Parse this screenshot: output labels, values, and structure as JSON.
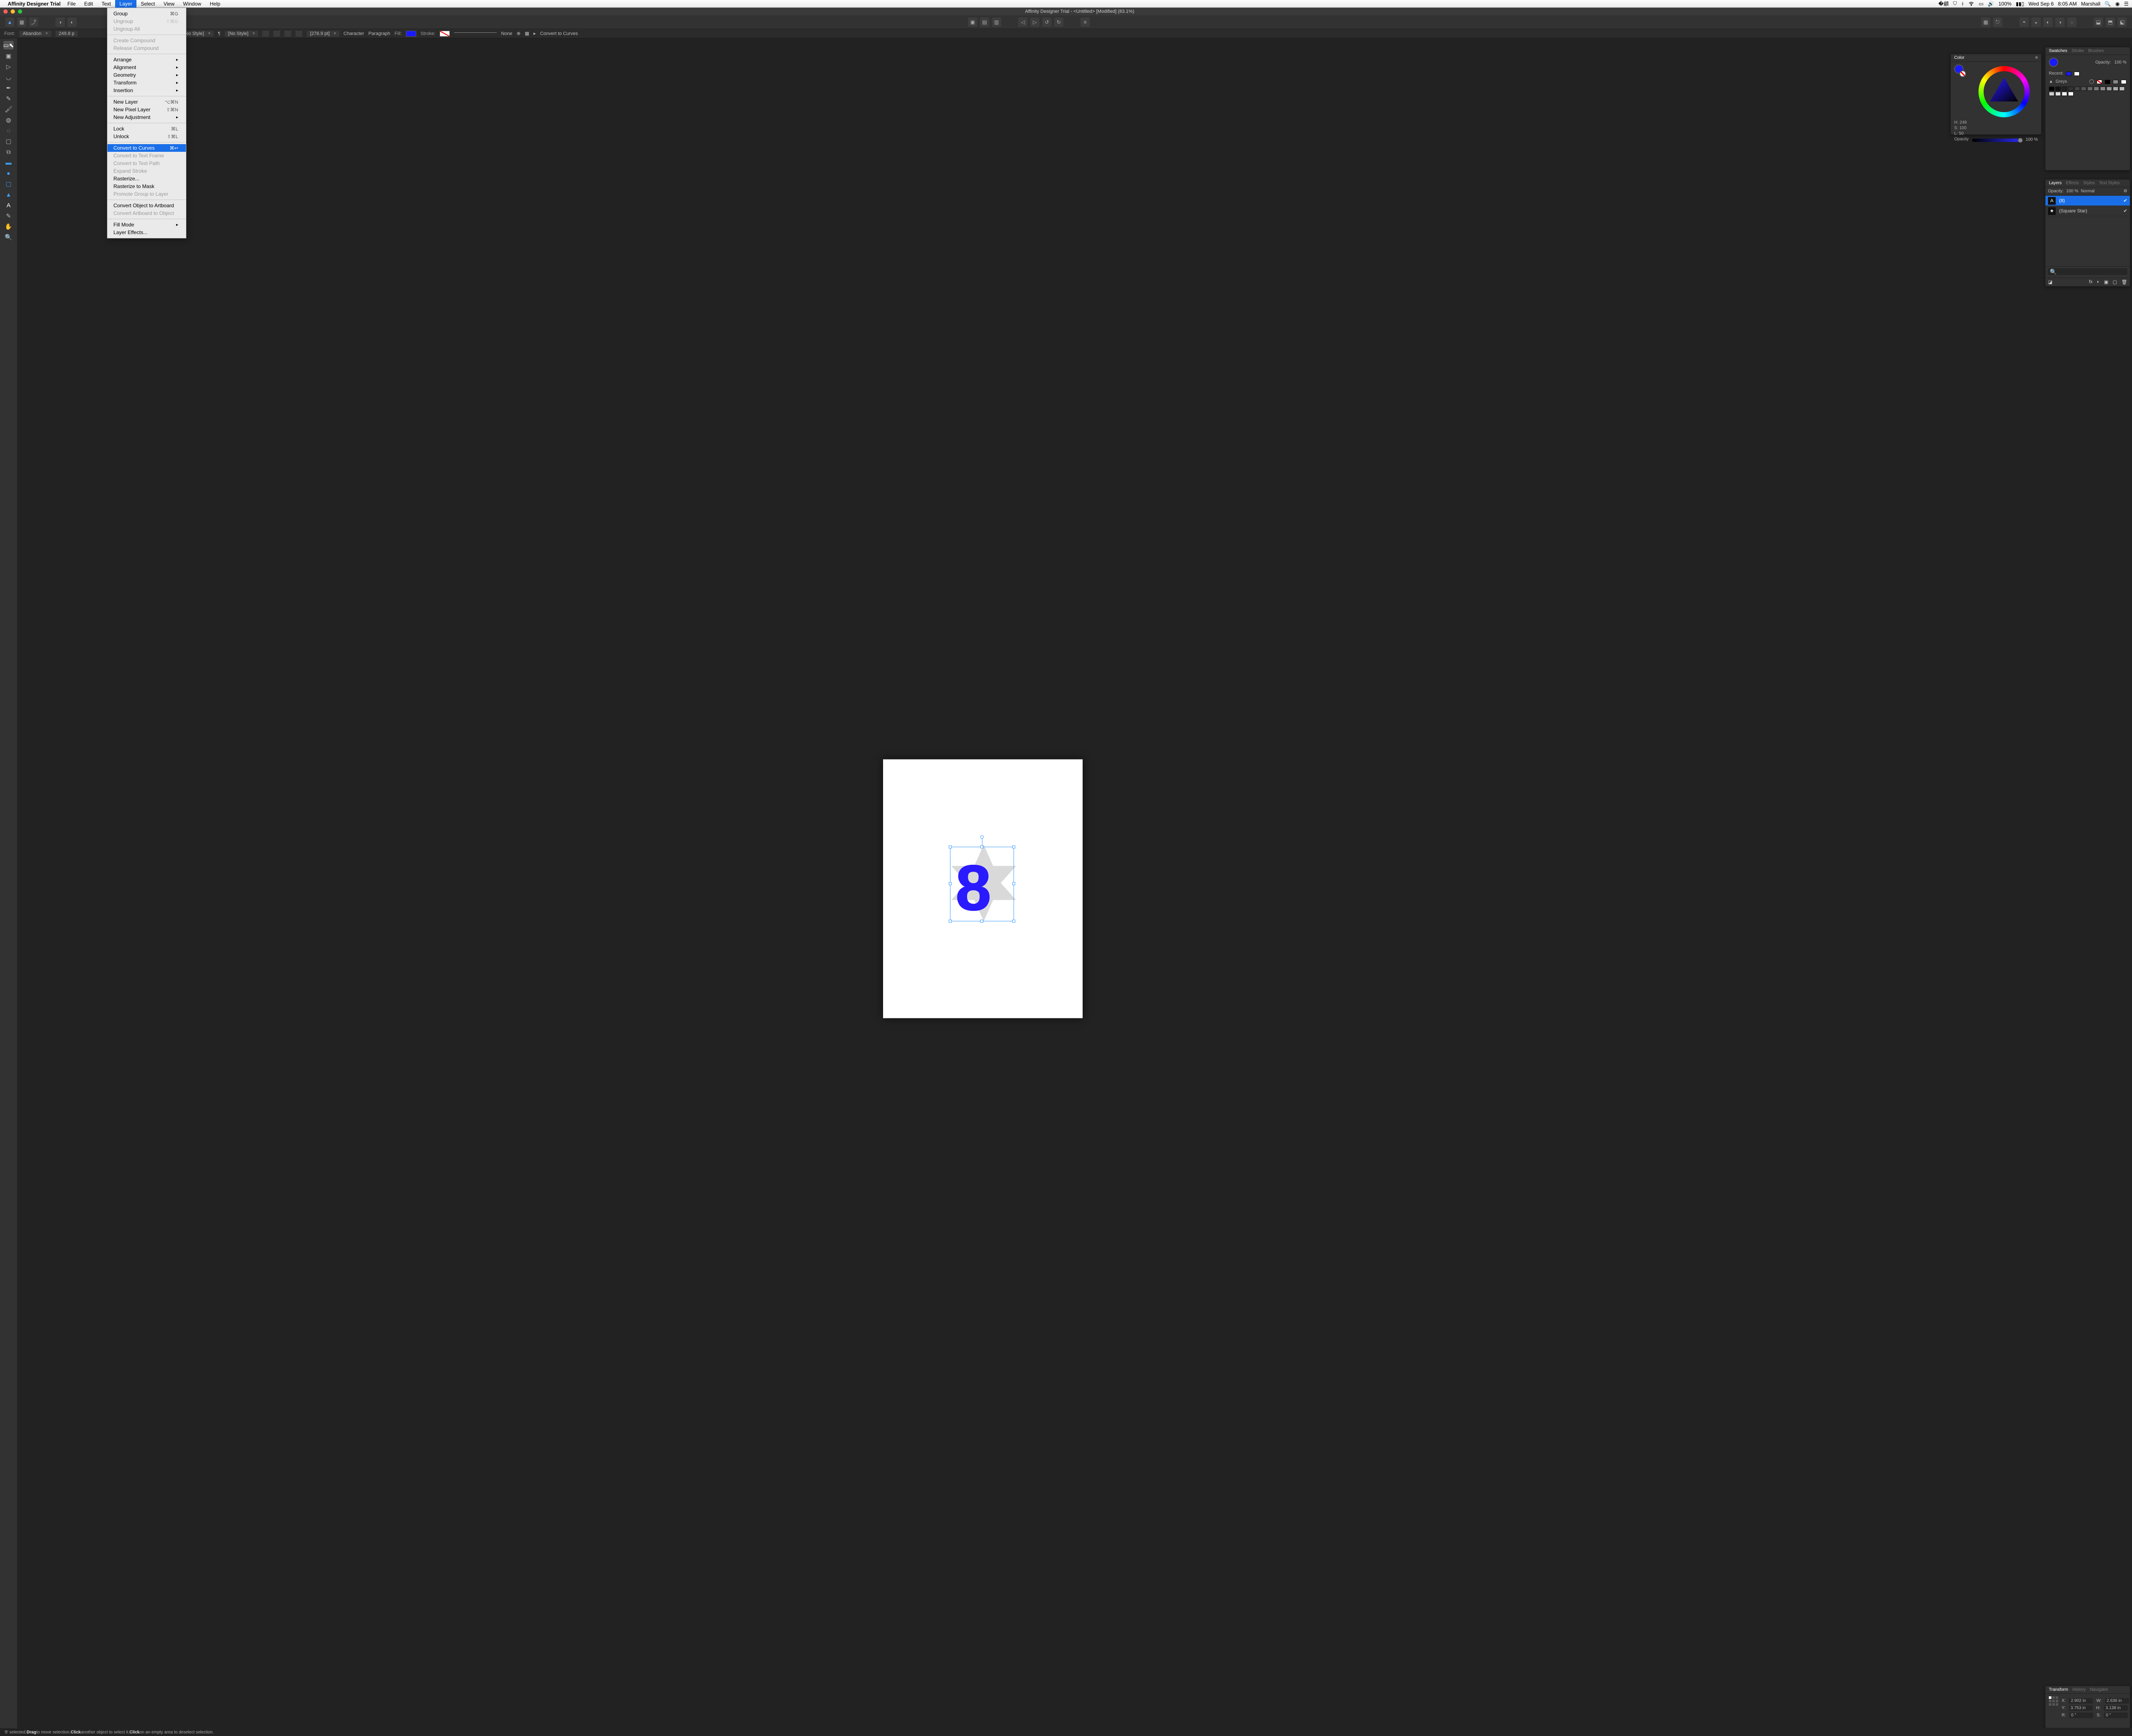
{
  "menubar": {
    "app_name": "Affinity Designer Trial",
    "items": [
      "File",
      "Edit",
      "Text",
      "Layer",
      "Select",
      "View",
      "Window",
      "Help"
    ],
    "active": "Layer",
    "right": {
      "battery": "100%",
      "battery_icon": "⚡",
      "date": "Wed Sep 6",
      "time": "8:05 AM",
      "user": "Marshall"
    }
  },
  "titlebar": {
    "title": "Affinity Designer Trial - <Untitled> [Modified] (83.1%)"
  },
  "contextbar": {
    "font_label": "Font:",
    "font_value": "Abandon",
    "size_value": "249.8 p",
    "style1_label": "[No Style]",
    "style2_label": "[No Style]",
    "leading_value": "[276.9 pt]",
    "character_btn": "Character",
    "paragraph_btn": "Paragraph",
    "fill_label": "Fill:",
    "fill_color": "#1a1aff",
    "stroke_label": "Stroke:",
    "stroke_none": "None",
    "convert_btn": "Convert to Curves"
  },
  "layer_menu": {
    "items": [
      {
        "label": "Group",
        "shortcut": "⌘G",
        "disabled": false
      },
      {
        "label": "Ungroup",
        "shortcut": "⇧⌘G",
        "disabled": true
      },
      {
        "label": "Ungroup All",
        "shortcut": "",
        "disabled": true
      },
      {
        "sep": true
      },
      {
        "label": "Create Compound",
        "shortcut": "",
        "disabled": true
      },
      {
        "label": "Release Compound",
        "shortcut": "",
        "disabled": true
      },
      {
        "sep": true
      },
      {
        "label": "Arrange",
        "submenu": true
      },
      {
        "label": "Alignment",
        "submenu": true
      },
      {
        "label": "Geometry",
        "submenu": true
      },
      {
        "label": "Transform",
        "submenu": true
      },
      {
        "label": "Insertion",
        "submenu": true
      },
      {
        "sep": true
      },
      {
        "label": "New Layer",
        "shortcut": "⌥⌘N"
      },
      {
        "label": "New Pixel Layer",
        "shortcut": "⇧⌘N"
      },
      {
        "label": "New Adjustment",
        "submenu": true
      },
      {
        "sep": true
      },
      {
        "label": "Lock",
        "shortcut": "⌘L"
      },
      {
        "label": "Unlock",
        "shortcut": "⇧⌘L"
      },
      {
        "sep": true
      },
      {
        "label": "Convert to Curves",
        "shortcut": "⌘↩",
        "selected": true
      },
      {
        "label": "Convert to Text Frame",
        "disabled": true
      },
      {
        "label": "Convert to Text Path",
        "disabled": true
      },
      {
        "label": "Expand Stroke",
        "disabled": true
      },
      {
        "label": "Rasterize..."
      },
      {
        "label": "Rasterize to Mask"
      },
      {
        "label": "Promote Group to Layer",
        "disabled": true
      },
      {
        "sep": true
      },
      {
        "label": "Convert Object to Artboard"
      },
      {
        "label": "Convert Artboard to Object",
        "disabled": true
      },
      {
        "sep": true
      },
      {
        "label": "Fill Mode",
        "submenu": true
      },
      {
        "label": "Layer Effects..."
      }
    ]
  },
  "color_panel": {
    "title": "Color",
    "h": "H: 249",
    "s": "S: 100",
    "l": "L: 50",
    "opacity_label": "Opacity",
    "opacity_value": "100 %"
  },
  "swatches_panel": {
    "tabs": [
      "Swatches",
      "Stroke",
      "Brushes"
    ],
    "opacity_label": "Opacity:",
    "opacity_value": "100 %",
    "recent_label": "Recent:",
    "palette": "Greys"
  },
  "layers_panel": {
    "tabs": [
      "Layers",
      "Effects",
      "Styles",
      "Text Styles"
    ],
    "opacity_label": "Opacity:",
    "opacity_value": "100 %",
    "blend": "Normal",
    "rows": [
      {
        "name": "(8)",
        "selected": true,
        "icon": "A"
      },
      {
        "name": "(Square Star)",
        "selected": false,
        "icon": "★"
      }
    ]
  },
  "transform_panel": {
    "tabs": [
      "Transform",
      "History",
      "Navigator"
    ],
    "x_label": "X:",
    "x": "2.902 in",
    "y_label": "Y:",
    "y": "3.753 in",
    "w_label": "W:",
    "w": "2.636 in",
    "h_label": "H:",
    "h": "3.138 in",
    "r_label": "R:",
    "r": "0 °",
    "s_label": "S:",
    "s": "0 °"
  },
  "statusbar": {
    "text_a": "'8' selected. ",
    "bold1": "Drag",
    "text_b": " to move selection. ",
    "bold2": "Click",
    "text_c": " another object to select it. ",
    "bold3": "Click",
    "text_d": " on an empty area to deselect selection."
  },
  "canvas": {
    "glyph": "8"
  }
}
